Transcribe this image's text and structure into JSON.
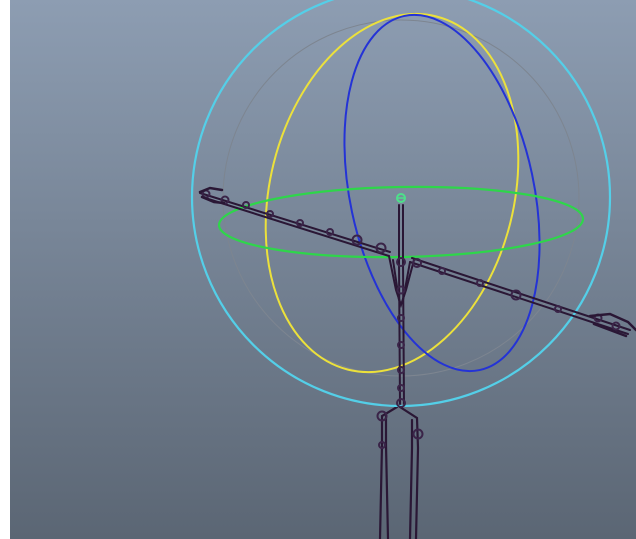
{
  "viewport": {
    "background_top": "#8d9db2",
    "background_bottom": "#5b6674"
  },
  "rotate_manipulator": {
    "outer_ring_color": "#54cfe8",
    "trackball_ring_color": "#7d8590",
    "x_axis_color": "#ff3030",
    "y_axis_ring_color": "#2ed64a",
    "z_axis_ring_color": "#ece13b",
    "x_axis_ring_color": "#2433d6",
    "center_marker_color": "#4de08a"
  },
  "skeleton": {
    "bone_color": "#2a1735",
    "joint_color": "#3a2448"
  }
}
